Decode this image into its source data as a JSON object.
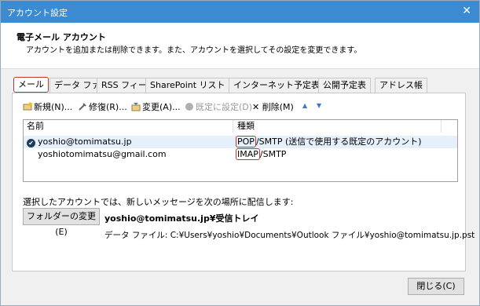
{
  "window": {
    "title": "アカウント設定",
    "close": "✕"
  },
  "header": {
    "title": "電子メール アカウント",
    "description": "アカウントを追加または削除できます。また、アカウントを選択してその設定を変更できます。"
  },
  "tabs": [
    {
      "label": "メール"
    },
    {
      "label": "データ ファイル"
    },
    {
      "label": "RSS フィード"
    },
    {
      "label": "SharePoint リスト"
    },
    {
      "label": "インターネット予定表"
    },
    {
      "label": "公開予定表"
    },
    {
      "label": "アドレス帳"
    }
  ],
  "toolbar": {
    "new": "新規(N)...",
    "repair": "修復(R)...",
    "change": "変更(A)...",
    "set_default": "既定に設定(D)",
    "delete": "削除(M)",
    "up": "▲",
    "down": "▼"
  },
  "accounts": {
    "headers": {
      "name": "名前",
      "type": "種類"
    },
    "rows": [
      {
        "name": "yoshio@tomimatsu.jp",
        "protocol": "POP",
        "type_rest": "/SMTP (送信で使用する既定のアカウント)",
        "default": "✔"
      },
      {
        "name": "yoshiotomimatsu@gmail.com",
        "protocol": "IMAP",
        "type_rest": "/SMTP"
      }
    ]
  },
  "delivery": {
    "label": "選択したアカウントでは、新しいメッセージを次の場所に配信します:",
    "change_folder_button": "フォルダーの変更(E)",
    "folder": "yoshio@tomimatsu.jp¥受信トレイ",
    "data_file": "データ ファイル: C:¥Users¥yoshio¥Documents¥Outlook ファイル¥yoshio@tomimatsu.jp.pst"
  },
  "footer": {
    "close_button": "閉じる(C)"
  }
}
